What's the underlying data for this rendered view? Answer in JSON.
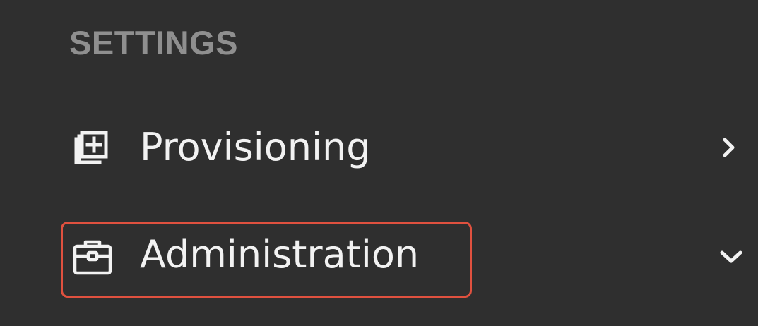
{
  "settings": {
    "section_title": "SETTINGS",
    "items": [
      {
        "label": "Provisioning",
        "icon": "provisioning-icon",
        "chevron": "chevron-right-icon",
        "expanded": false
      },
      {
        "label": "Administration",
        "icon": "briefcase-icon",
        "chevron": "chevron-down-icon",
        "expanded": true,
        "highlighted": true
      }
    ]
  },
  "colors": {
    "background": "#2f2f2f",
    "section_title": "#8f8f8f",
    "item_text": "#f2f2f2",
    "highlight_border": "#e0513f"
  }
}
